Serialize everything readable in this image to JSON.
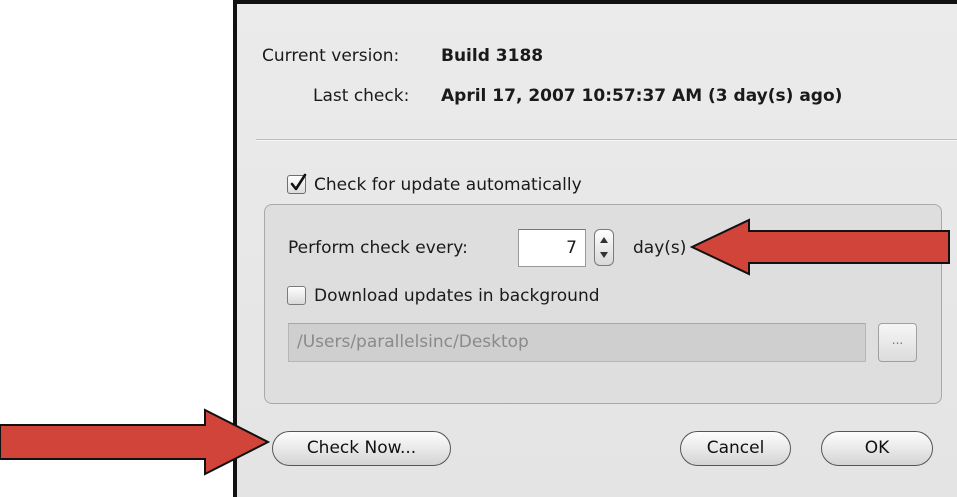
{
  "info": {
    "version_label": "Current version:",
    "version_value": "Build 3188",
    "last_check_label": "Last check:",
    "last_check_value": "April 17, 2007 10:57:37 AM (3 day(s) ago)"
  },
  "update": {
    "auto_check_label": "Check for update automatically",
    "auto_check_checked": true,
    "perform_label": "Perform check every:",
    "interval_value": "7",
    "interval_unit": "day(s)",
    "download_label": "Download updates in background",
    "download_checked": false,
    "path_value": "/Users/parallelsinc/Desktop",
    "browse_label": "..."
  },
  "buttons": {
    "check_now": "Check Now...",
    "cancel": "Cancel",
    "ok": "OK"
  },
  "colors": {
    "annotation_arrow": "#d0443a",
    "dialog_background": "#e8e8e8"
  }
}
